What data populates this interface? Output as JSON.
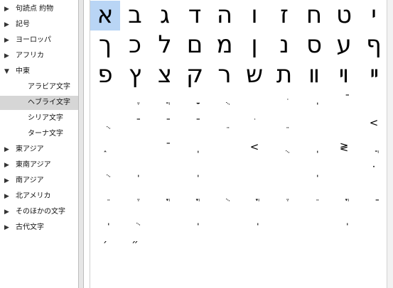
{
  "sidebar": {
    "items": [
      {
        "label": "句読点 約物",
        "expander": "▶",
        "child": false,
        "selected": false
      },
      {
        "label": "記号",
        "expander": "▶",
        "child": false,
        "selected": false
      },
      {
        "label": "ヨーロッパ",
        "expander": "▶",
        "child": false,
        "selected": false
      },
      {
        "label": "アフリカ",
        "expander": "▶",
        "child": false,
        "selected": false
      },
      {
        "label": "中東",
        "expander": "▼",
        "child": false,
        "selected": false
      },
      {
        "label": "アラビア文字",
        "expander": "",
        "child": true,
        "selected": false
      },
      {
        "label": "ヘブライ文字",
        "expander": "",
        "child": true,
        "selected": true
      },
      {
        "label": "シリア文字",
        "expander": "",
        "child": true,
        "selected": false
      },
      {
        "label": "ターナ文字",
        "expander": "",
        "child": true,
        "selected": false
      },
      {
        "label": "東アジア",
        "expander": "▶",
        "child": false,
        "selected": false
      },
      {
        "label": "東南アジア",
        "expander": "▶",
        "child": false,
        "selected": false
      },
      {
        "label": "南アジア",
        "expander": "▶",
        "child": false,
        "selected": false
      },
      {
        "label": "北アメリカ",
        "expander": "▶",
        "child": false,
        "selected": false
      },
      {
        "label": "そのほかの文字",
        "expander": "▶",
        "child": false,
        "selected": false
      },
      {
        "label": "古代文字",
        "expander": "▶",
        "child": false,
        "selected": false
      }
    ]
  },
  "grid": {
    "selected_index": 0,
    "selection_color": "#b9d5f5",
    "large_rows": [
      [
        "א",
        "ב",
        "ג",
        "ד",
        "ה",
        "ו",
        "ז",
        "ח",
        "ט",
        "י"
      ],
      [
        "ך",
        "כ",
        "ל",
        "ם",
        "מ",
        "ן",
        "נ",
        "ס",
        "ע",
        "ף"
      ],
      [
        "פ",
        "ץ",
        "צ",
        "ק",
        "ר",
        "ש",
        "ת",
        "װ",
        "ױ",
        "ײ"
      ]
    ],
    "small_rows": [
      [
        "",
        "ֶ",
        "ֲ",
        "ָ",
        "ֻ",
        "",
        "ּ",
        "ֽ",
        "ֿ",
        ""
      ],
      [
        "ֻ",
        "ֿ",
        "ֿ",
        "ֿ",
        "ֵ",
        "ֹ",
        "ֵ",
        "",
        "",
        "<"
      ],
      [
        "֑",
        "",
        "ֿ",
        "ֽ",
        "",
        "<",
        "ֻ",
        "ֽ",
        "≷",
        "ֲ"
      ],
      [
        "ֻ",
        "ֽ",
        "",
        "ֽ",
        "",
        "",
        "",
        "ֽ",
        "",
        "֗"
      ],
      [
        "ֵ",
        "ֶ",
        "ֳ",
        "ֳ",
        "ֻ",
        "ֳ",
        "ֶ",
        "ֵ",
        "ֳ",
        "ַ"
      ],
      [
        "ֽ",
        "ֻ",
        "",
        "ֽ",
        "",
        "ֽ",
        "",
        "",
        "ֽ",
        ""
      ],
      [
        "׳",
        "״",
        "",
        "",
        "",
        "",
        "",
        "",
        "",
        ""
      ]
    ]
  }
}
